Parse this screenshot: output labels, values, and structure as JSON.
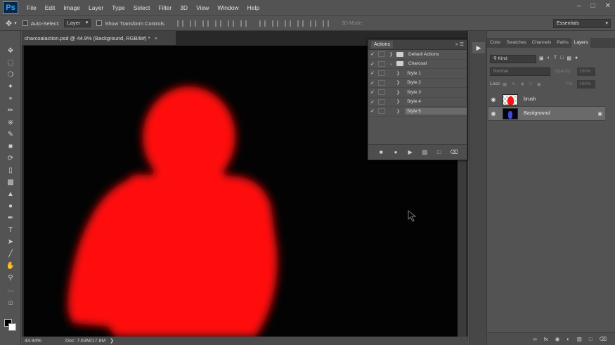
{
  "app": {
    "logo_text": "Ps"
  },
  "menu": [
    "File",
    "Edit",
    "Image",
    "Layer",
    "Type",
    "Select",
    "Filter",
    "3D",
    "View",
    "Window",
    "Help"
  ],
  "options_bar": {
    "auto_select_label": "Auto-Select:",
    "auto_select_value": "Layer",
    "show_transform_label": "Show Transform Controls",
    "mode_3d_label": "3D Mode:",
    "workspace": "Essentials"
  },
  "document": {
    "tab_title": "charcoalaction.psd @ 44.9% (Background, RGB/8#) *",
    "zoom": "44.94%",
    "doc_size": "Doc: 7.63M/17.8M"
  },
  "actions_panel": {
    "title": "Actions",
    "rows": [
      {
        "label": "Default Actions",
        "type": "set",
        "checked": true
      },
      {
        "label": "Charcoal",
        "type": "set",
        "checked": true
      },
      {
        "label": "Style 1",
        "type": "action",
        "checked": true
      },
      {
        "label": "Style 2",
        "type": "action",
        "checked": true
      },
      {
        "label": "Style 3",
        "type": "action",
        "checked": true
      },
      {
        "label": "Style 4",
        "type": "action",
        "checked": true
      },
      {
        "label": "Style 5",
        "type": "action",
        "checked": true,
        "selected": true
      }
    ]
  },
  "layers_panel": {
    "tabs": [
      "Color",
      "Swatches",
      "Channels",
      "Paths",
      "Layers"
    ],
    "active_tab": "Layers",
    "filter_value": "Kind",
    "blend_mode": "Normal",
    "opacity_label": "Opacity:",
    "opacity_value": "100%",
    "lock_label": "Lock:",
    "fill_label": "Fill:",
    "fill_value": "100%",
    "layers": [
      {
        "name": "brush",
        "thumb": "red-figure-on-transparent",
        "locked": false,
        "selected": false
      },
      {
        "name": "Background",
        "thumb": "blue-figure-on-black",
        "locked": true,
        "selected": true
      }
    ]
  },
  "colors": {
    "canvas_bg": "#030303",
    "figure": "#ff0a0a",
    "ui_panel": "#535353",
    "ui_dark": "#282828"
  }
}
